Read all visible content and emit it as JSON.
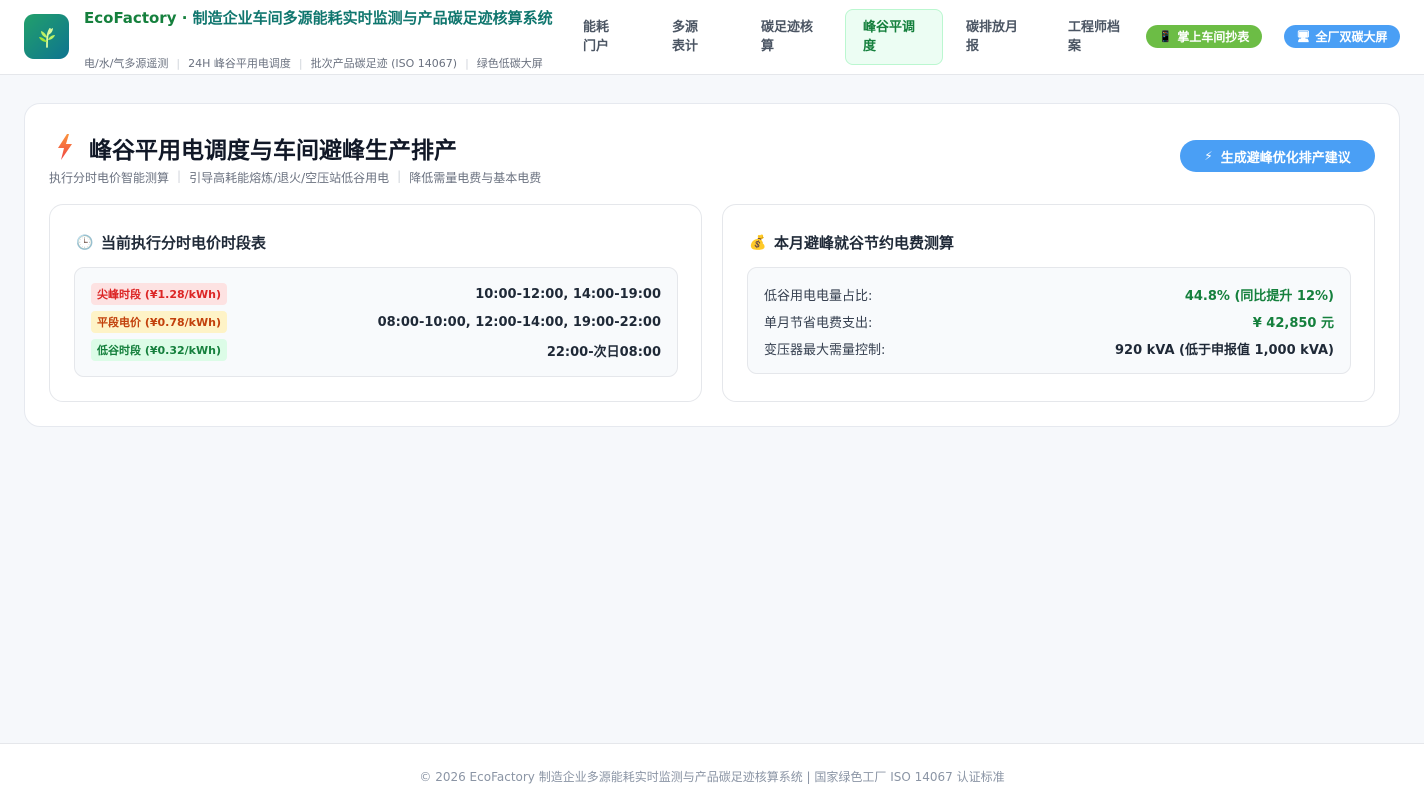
{
  "header": {
    "brand_name": "EcoFactory · ",
    "brand_rest": "制造企业车间多源能耗实时监测与产品碳足迹核算系统",
    "tags": [
      "电/水/气多源遥测",
      "24H 峰谷平用电调度",
      "批次产品碳足迹 (ISO 14067)",
      "绿色低碳大屏"
    ],
    "nav": [
      {
        "label": "能耗门户",
        "active": false
      },
      {
        "label": "多源表计",
        "active": false
      },
      {
        "label": "碳足迹核算",
        "active": false
      },
      {
        "label": "峰谷平调度",
        "active": true
      },
      {
        "label": "碳排放月报",
        "active": false
      },
      {
        "label": "工程师档案",
        "active": false
      }
    ],
    "mobile_btn": {
      "icon": "📱",
      "label": "掌上车间抄表"
    },
    "screen_btn": {
      "icon": "🖥",
      "label": "全厂双碳大屏"
    }
  },
  "page": {
    "title": "峰谷平用电调度与车间避峰生产排产",
    "subtitle": [
      "执行分时电价智能测算",
      "引导高耗能熔炼/退火/空压站低谷用电",
      "降低需量电费与基本电费"
    ],
    "generate_btn": {
      "icon": "⚡",
      "label": "生成避峰优化排产建议"
    }
  },
  "tariff": {
    "title": "当前执行分时电价时段表",
    "icon": "🕒",
    "rows": [
      {
        "badge": "尖峰时段 (¥1.28/kWh)",
        "value": "10:00-12:00, 14:00-19:00"
      },
      {
        "badge": "平段电价 (¥0.78/kWh)",
        "value": "08:00-10:00, 12:00-14:00, 19:00-22:00"
      },
      {
        "badge": "低谷时段 (¥0.32/kWh)",
        "value": "22:00-次日08:00"
      }
    ]
  },
  "savings": {
    "title": "本月避峰就谷节约电费测算",
    "icon": "💰",
    "rows": [
      {
        "label": "低谷用电电量占比:",
        "value": "44.8% (同比提升 12%)"
      },
      {
        "label": "单月节省电费支出:",
        "value": "¥ 42,850 元"
      },
      {
        "label": "变压器最大需量控制:",
        "value": "920 kVA (低于申报值 1,000 kVA)"
      }
    ]
  },
  "footer": {
    "text": "© 2026 EcoFactory 制造企业多源能耗实时监测与产品碳足迹核算系统 | 国家绿色工厂 ISO 14067 认证标准"
  },
  "colors": {
    "brand_green": "#15803d",
    "accent_blue": "#4a9ff5",
    "pill_green": "#6cbd45",
    "peak_red": "#dc2626",
    "flat_orange": "#c2410c"
  }
}
